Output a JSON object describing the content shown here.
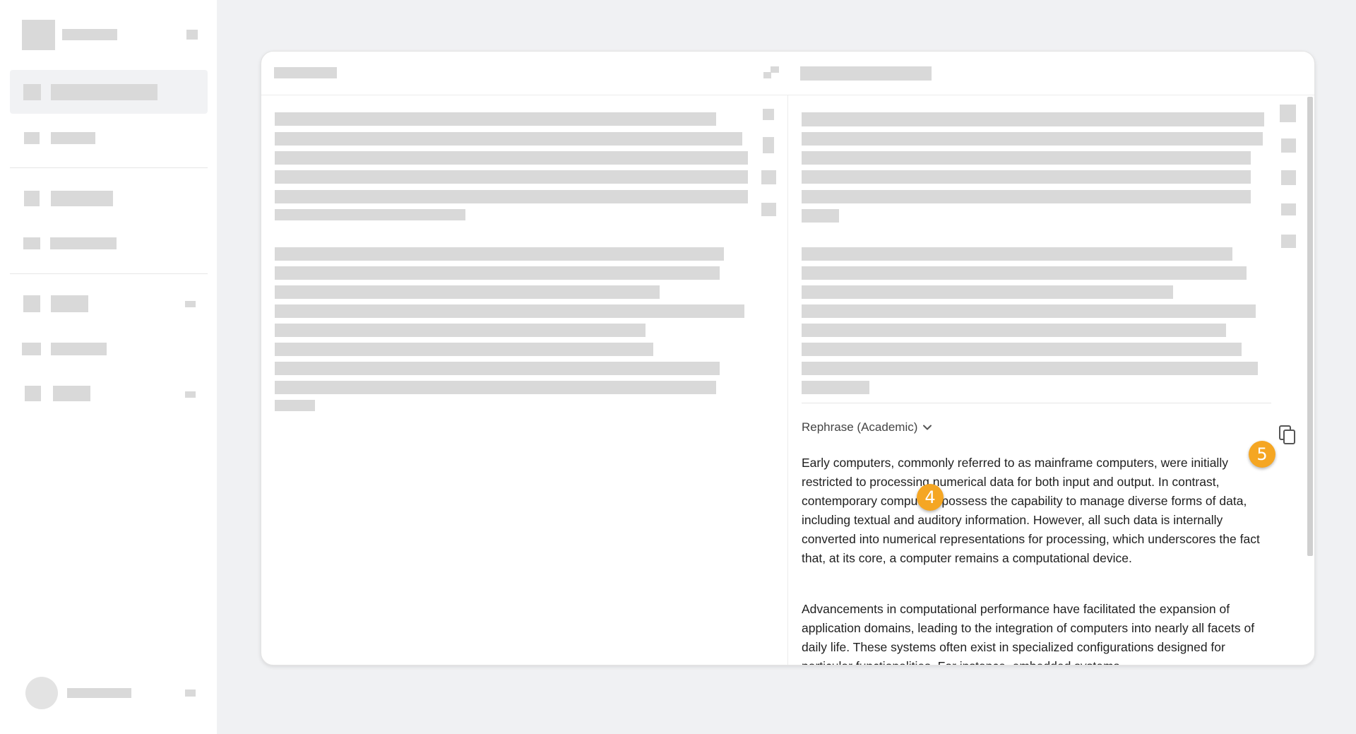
{
  "output": {
    "mode_label": "Rephrase (Academic)",
    "paragraphs": [
      "Early computers, commonly referred to as mainframe computers, were initially restricted to processing numerical data for both input and output. In contrast, contemporary computers possess the capability to manage diverse forms of data, including textual and auditory information. However, all such data is internally converted into numerical representations for processing, which underscores the fact that, at its core, a computer remains a computational device.",
      "Advancements in computational performance have facilitated the expansion of application domains, leading to the integration of computers into nearly all facets of daily life. These systems often exist in specialized configurations designed for particular functionalities. For instance, embedded systems"
    ]
  },
  "markers": {
    "copy_hint": "5",
    "text_hint": "4"
  },
  "icons": {
    "mode_dropdown": "chevron-down-icon",
    "copy": "copy-icon",
    "swap": "swap-icon"
  },
  "colors": {
    "accent_marker": "#f5a623",
    "placeholder": "#d9d9d9",
    "background": "#f0f1f3"
  }
}
